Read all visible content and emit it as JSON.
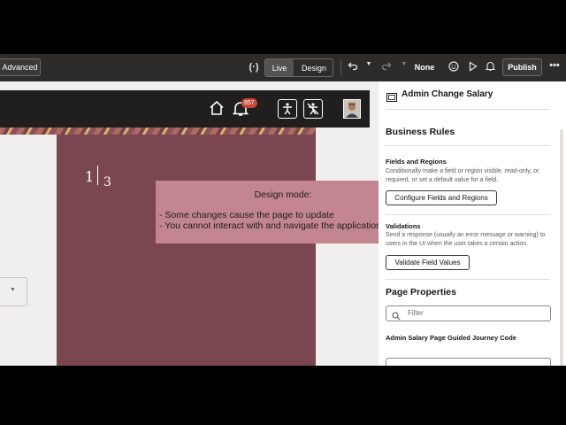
{
  "toolbar": {
    "advanced_label": "Advanced",
    "code_icon_text": "(·)",
    "live_label": "Live",
    "design_label": "Design",
    "undo_icon": "undo-icon",
    "redo_icon": "redo-icon",
    "none_label": "None",
    "emoji_icon": "smiley-icon",
    "preview_icon": "play-icon",
    "bell_icon": "bell-icon",
    "publish_label": "Publish",
    "more_icon": "more-icon"
  },
  "canvas": {
    "notification_count": "857",
    "step_current": "1",
    "step_total": "3",
    "popup": {
      "title": "Design mode:",
      "line1": "- Some changes cause the page to update",
      "line2": "- You cannot interact with and navigate the application"
    }
  },
  "panel": {
    "page_title": "Admin Change Salary",
    "business_rules_heading": "Business Rules",
    "fields_regions": {
      "title": "Fields and Regions",
      "desc": "Conditionally make a field or region visible, read-only, or required, or set a default value for a field.",
      "button": "Configure Fields and Regions"
    },
    "validations": {
      "title": "Validations",
      "desc": "Send a response (usually an error message or warning) to users in the UI when the user takes a certain action.",
      "button": "Validate Field Values"
    },
    "page_properties_heading": "Page Properties",
    "filter_placeholder": "Filter",
    "journey_label": "Admin Salary Page Guided Journey Code"
  },
  "colors": {
    "toolbar_bg": "#2d2c2a",
    "app_header_bg": "#201f1d",
    "card_bg": "#7a4650",
    "popup_bg": "#c38690",
    "notification_badge": "#c74634"
  }
}
